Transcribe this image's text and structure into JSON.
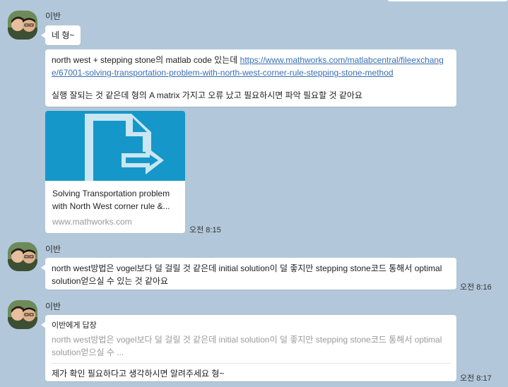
{
  "messages": [
    {
      "sender": "이반",
      "greeting": "네 형~",
      "text_line": "north west + stepping stone의 matlab code 있는데 ",
      "link": "https://www.mathworks.com/matlabcentral/fileexchange/67001-solving-transportation-problem-with-north-west-corner-rule-stepping-stone-method",
      "text_after": "실행 잘되는 것 같은데 형의 A matrix 가지고 오류 났고 필요하시면 파악 필요할 것 같아요",
      "card": {
        "title": "Solving Transportation problem with North West corner rule &...",
        "domain": "www.mathworks.com"
      },
      "time": "오전 8:15"
    },
    {
      "sender": "이반",
      "text": "north west방법은 vogel보다 덜 걸릴 것 같은데 initial solution이 덜 좋지만 stepping stone코드 통해서 optimal solution얻으실 수 있는 것 같아요",
      "time": "오전 8:16"
    },
    {
      "sender": "이반",
      "reply_to": "이반에게 답장",
      "quoted": "north west방법은 vogel보다 덜 걸릴 것 같은데 initial solution이 덜 좋지만 stepping stone코드 통해서 optimal solution얻으실 수 ...",
      "text": "제가 확인 필요하다고 생각하시면 알려주세요 형~",
      "time": "오전 8:17"
    }
  ],
  "colors": {
    "background": "#b2c7d9",
    "bubble": "#ffffff",
    "link": "#3a6fb0",
    "thumbnail": "#1597c9"
  },
  "icons": {
    "card_thumbnail": "export-arrow-icon"
  }
}
